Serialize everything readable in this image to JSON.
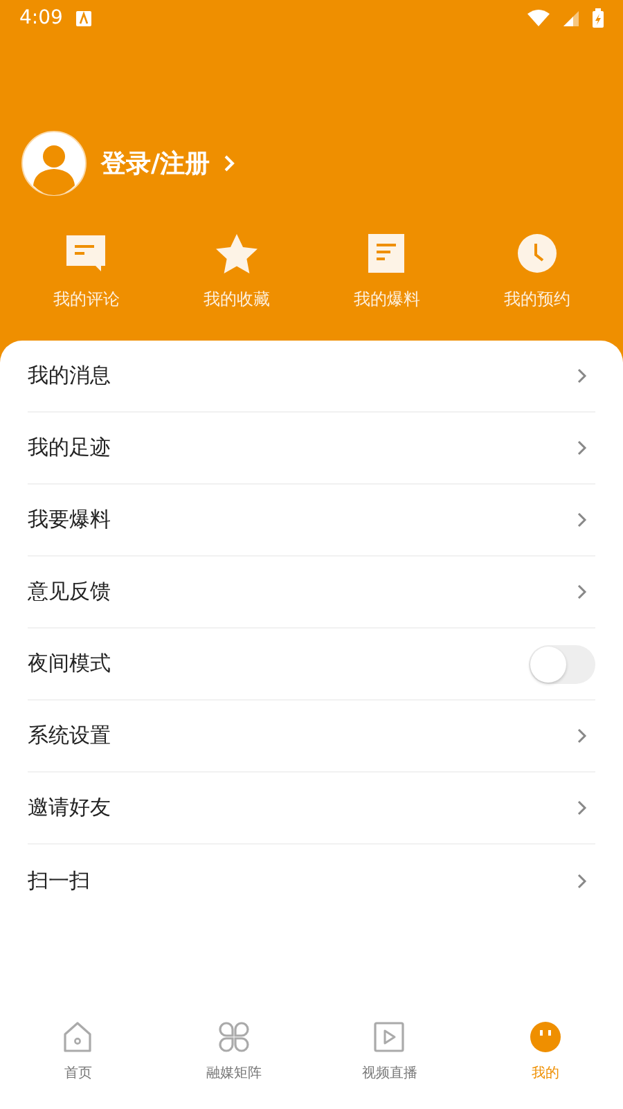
{
  "status_bar": {
    "time": "4:09"
  },
  "profile": {
    "login_label": "登录/注册"
  },
  "shortcuts": [
    {
      "label": "我的评论",
      "kind": "comment"
    },
    {
      "label": "我的收藏",
      "kind": "star"
    },
    {
      "label": "我的爆料",
      "kind": "doc"
    },
    {
      "label": "我的预约",
      "kind": "clock"
    }
  ],
  "menu": [
    {
      "label": "我的消息",
      "kind": "link"
    },
    {
      "label": "我的足迹",
      "kind": "link"
    },
    {
      "label": "我要爆料",
      "kind": "link"
    },
    {
      "label": "意见反馈",
      "kind": "link"
    },
    {
      "label": "夜间模式",
      "kind": "toggle",
      "on": false
    },
    {
      "label": "系统设置",
      "kind": "link"
    },
    {
      "label": "邀请好友",
      "kind": "link"
    },
    {
      "label": "扫一扫",
      "kind": "link"
    }
  ],
  "bottom_nav": [
    {
      "label": "首页",
      "kind": "home",
      "selected": false
    },
    {
      "label": "融媒矩阵",
      "kind": "grid",
      "selected": false
    },
    {
      "label": "视频直播",
      "kind": "video",
      "selected": false
    },
    {
      "label": "我的",
      "kind": "me",
      "selected": true
    }
  ]
}
